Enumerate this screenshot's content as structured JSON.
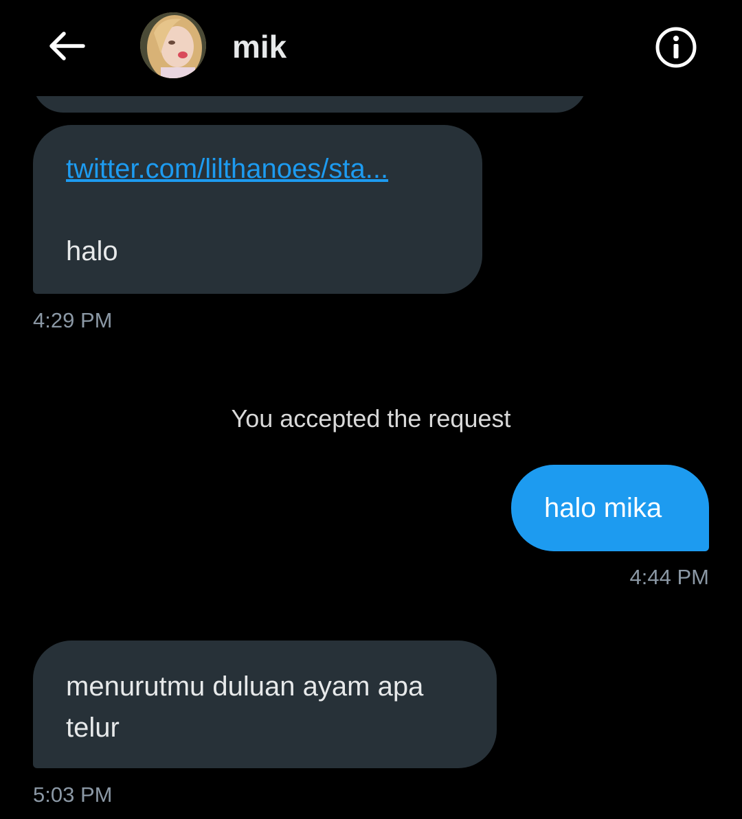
{
  "header": {
    "title": "mik",
    "back_icon": "arrow-left-icon",
    "info_icon": "info-circle-icon"
  },
  "messages": [
    {
      "direction": "incoming",
      "link": "twitter.com/lilthanoes/sta...",
      "text": "halo",
      "time": "4:29 PM"
    },
    {
      "direction": "outgoing",
      "text": "halo mika",
      "time": "4:44 PM"
    },
    {
      "direction": "incoming",
      "text": "menurutmu duluan ayam apa telur",
      "time": "5:03 PM"
    }
  ],
  "system_note": "You accepted the request",
  "colors": {
    "background": "#000000",
    "incoming_bubble": "#273138",
    "outgoing_bubble": "#1d9bf0",
    "link": "#1d9bf0",
    "timestamp": "#8b98a5"
  }
}
